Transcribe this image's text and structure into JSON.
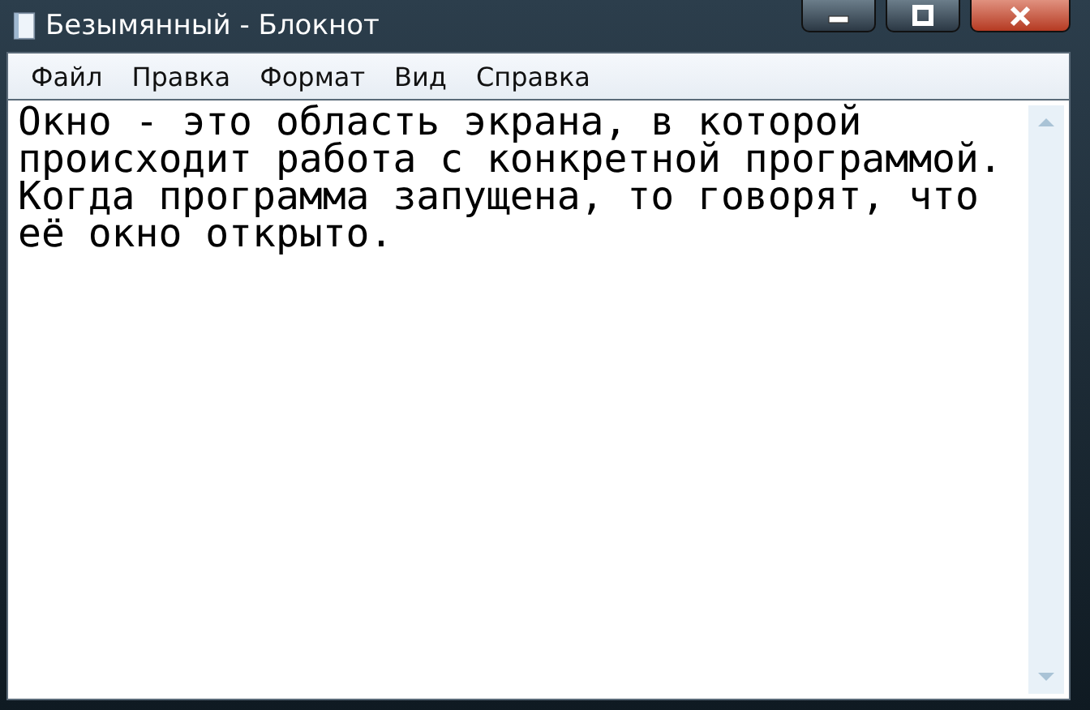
{
  "window": {
    "title": "Безымянный - Блокнот"
  },
  "menu": [
    {
      "label": "Файл"
    },
    {
      "label": "Правка"
    },
    {
      "label": "Формат"
    },
    {
      "label": "Вид"
    },
    {
      "label": "Справка"
    }
  ],
  "document": {
    "lines": [
      "Окно - это область экрана, в которой",
      "происходит работа с конкретной программой.",
      "Когда программа запущена, то говорят, что",
      "её окно открыто."
    ]
  }
}
